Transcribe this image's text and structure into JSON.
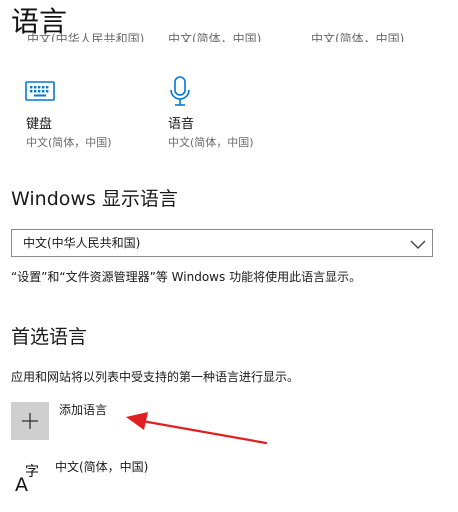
{
  "page": {
    "title": "语言"
  },
  "top_row_cut": [
    "中文(中华人民共和国)",
    "中文(简体，中国)",
    "中文(简体，中国)"
  ],
  "tiles": [
    {
      "label": "键盘",
      "sub": "中文(简体，中国)",
      "icon": "keyboard-icon"
    },
    {
      "label": "语音",
      "sub": "中文(简体，中国)",
      "icon": "microphone-icon"
    }
  ],
  "display_language": {
    "heading": "Windows 显示语言",
    "selected": "中文(中华人民共和国)",
    "helper": "“设置”和“文件资源管理器”等 Windows 功能将使用此语言显示。"
  },
  "preferred_languages": {
    "heading": "首选语言",
    "helper": "应用和网站将以列表中受支持的第一种语言进行显示。",
    "add_label": "添加语言",
    "items": [
      {
        "label": "中文(简体，中国)",
        "icon": "language-icon"
      }
    ]
  },
  "colors": {
    "accent": "#0078d7",
    "annotation_arrow": "#e02020",
    "add_button_bg": "#cfcfcf"
  }
}
